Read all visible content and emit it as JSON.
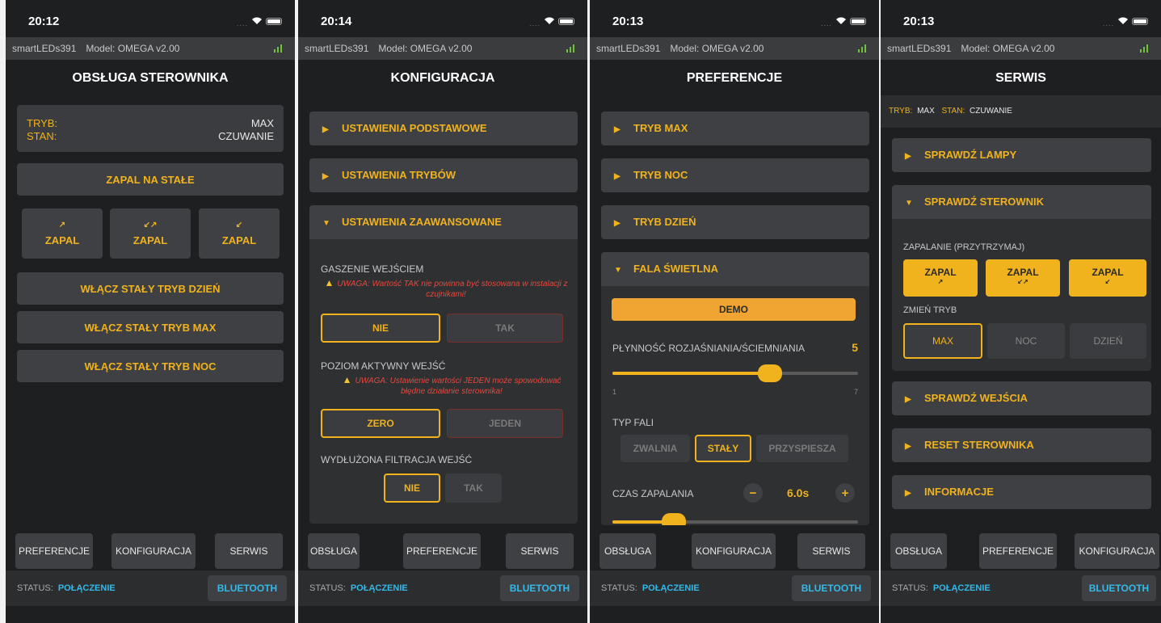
{
  "colors": {
    "accent": "#f0b21d",
    "status": "#34b9e8",
    "warning": "#e34a3f"
  },
  "device": {
    "name": "smartLEDs391",
    "model": "Model: OMEGA v2.00"
  },
  "status": {
    "label": "STATUS:",
    "value": "POŁĄCZENIE",
    "bluetooth": "BLUETOOTH"
  },
  "s1": {
    "time": "20:12",
    "title": "OBSŁUGA STEROWNIKA",
    "tryb_label": "TRYB:",
    "tryb_value": "MAX",
    "stan_label": "STAN:",
    "stan_value": "CZUWANIE",
    "zapal_na_stale": "ZAPAL NA STAŁE",
    "zapal": [
      "ZAPAL",
      "ZAPAL",
      "ZAPAL"
    ],
    "zapal_arrows": [
      "↗",
      "↙↗",
      "↙"
    ],
    "dzien": "WŁĄCZ STAŁY TRYB DZIEŃ",
    "max": "WŁĄCZ STAŁY TRYB MAX",
    "noc": "WŁĄCZ STAŁY TRYB NOC",
    "nav": [
      "PREFERENCJE",
      "KONFIGURACJA",
      "SERWIS"
    ]
  },
  "s2": {
    "time": "20:14",
    "title": "KONFIGURACJA",
    "acc": [
      "USTAWIENIA PODSTAWOWE",
      "USTAWIENIA TRYBÓW",
      "USTAWIENIA ZAAWANSOWANE"
    ],
    "gaszenie": "GASZENIE WEJŚCIEM",
    "warn1": "UWAGA: Wartość TAK nie powinna być stosowana w instalacji z czujnikami!",
    "nie": "NIE",
    "tak": "TAK",
    "poziom": "POZIOM AKTYWNY WEJŚĆ",
    "warn2": "UWAGA: Ustawienie wartości JEDEN może spowodować błędne działanie sterownika!",
    "zero": "ZERO",
    "jeden": "JEDEN",
    "filtr": "WYDŁUŻONA FILTRACJA WEJŚĆ",
    "nav": [
      "OBSŁUGA",
      "PREFERENCJE",
      "SERWIS"
    ]
  },
  "s3": {
    "time": "20:13",
    "title": "PREFERENCJE",
    "acc": [
      "TRYB MAX",
      "TRYB NOC",
      "TRYB DZIEŃ",
      "FALA ŚWIETLNA"
    ],
    "demo": "DEMO",
    "plynnosc": "PŁYNNOŚĆ ROZJAŚNIANIA/ŚCIEMNIANIA",
    "plynnosc_value": "5",
    "slider_min": "1",
    "slider_max": "7",
    "typ": "TYP FALI",
    "zwalnia": "ZWALNIA",
    "staly": "STAŁY",
    "przyspiesza": "PRZYSPIESZA",
    "czas": "CZAS ZAPALANIA",
    "czas_value": "6.0s",
    "minus": "−",
    "plus": "+",
    "nav": [
      "OBSŁUGA",
      "KONFIGURACJA",
      "SERWIS"
    ]
  },
  "s4": {
    "time": "20:13",
    "title": "SERWIS",
    "tryb_label": "TRYB:",
    "tryb_value": "MAX",
    "stan_label": "STAN:",
    "stan_value": "CZUWANIE",
    "acc_top": [
      "SPRAWDŹ LAMPY",
      "SPRAWDŹ STEROWNIK"
    ],
    "zapalanie": "ZAPALANIE (PRZYTRZYMAJ)",
    "zapal": [
      "ZAPAL",
      "ZAPAL",
      "ZAPAL"
    ],
    "zapal_arrows": [
      "↗",
      "↙↗",
      "↙"
    ],
    "zmien": "ZMIEŃ TRYB",
    "max": "MAX",
    "noc": "NOC",
    "dzien": "DZIEŃ",
    "acc_bottom": [
      "SPRAWDŹ WEJŚCIA",
      "RESET STEROWNIKA",
      "INFORMACJE"
    ],
    "nav": [
      "OBSŁUGA",
      "PREFERENCJE",
      "KONFIGURACJA"
    ]
  }
}
